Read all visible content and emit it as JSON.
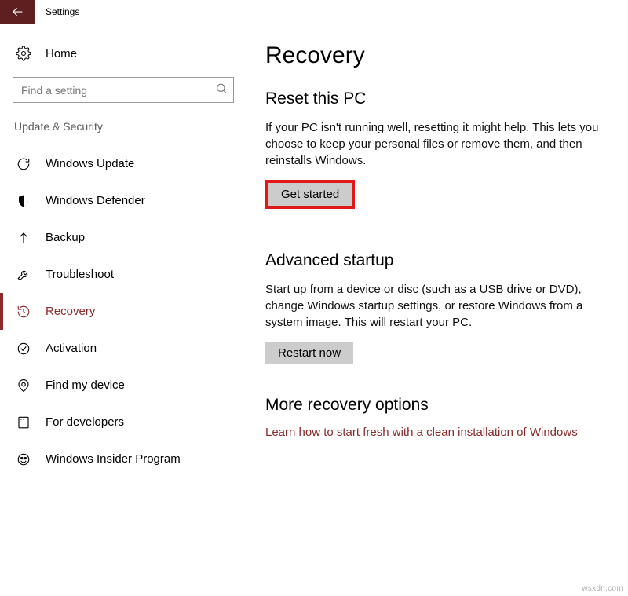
{
  "window_title": "Settings",
  "home_label": "Home",
  "search_placeholder": "Find a setting",
  "category": "Update & Security",
  "nav": [
    {
      "label": "Windows Update"
    },
    {
      "label": "Windows Defender"
    },
    {
      "label": "Backup"
    },
    {
      "label": "Troubleshoot"
    },
    {
      "label": "Recovery"
    },
    {
      "label": "Activation"
    },
    {
      "label": "Find my device"
    },
    {
      "label": "For developers"
    },
    {
      "label": "Windows Insider Program"
    }
  ],
  "page": {
    "title": "Recovery",
    "reset": {
      "heading": "Reset this PC",
      "desc": "If your PC isn't running well, resetting it might help. This lets you choose to keep your personal files or remove them, and then reinstalls Windows.",
      "button": "Get started"
    },
    "advanced": {
      "heading": "Advanced startup",
      "desc": "Start up from a device or disc (such as a USB drive or DVD), change Windows startup settings, or restore Windows from a system image. This will restart your PC.",
      "button": "Restart now"
    },
    "more": {
      "heading": "More recovery options",
      "link": "Learn how to start fresh with a clean installation of Windows"
    }
  },
  "watermark": "wsxdn.com"
}
